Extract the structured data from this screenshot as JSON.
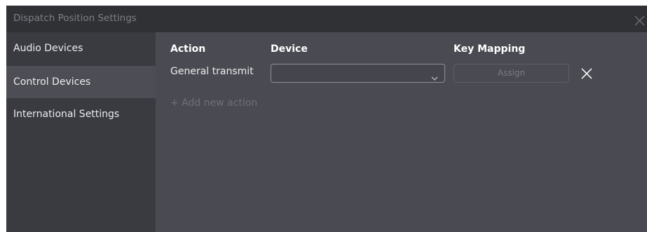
{
  "window": {
    "title": "Dispatch Position Settings",
    "close_icon": "close-icon"
  },
  "sidebar": {
    "items": [
      {
        "label": "Audio Devices",
        "active": false
      },
      {
        "label": "Control Devices",
        "active": true
      },
      {
        "label": "International Settings",
        "active": false
      }
    ]
  },
  "table": {
    "headers": {
      "action": "Action",
      "device": "Device",
      "key_mapping": "Key Mapping"
    },
    "rows": [
      {
        "action": "General transmit",
        "device": "",
        "assign_label": "Assign",
        "assign_enabled": false,
        "remove_icon": "close-icon"
      }
    ],
    "add_action_label": "+ Add new action"
  },
  "colors": {
    "titlebar": "#303135",
    "sidebar": "#3a3b41",
    "sidebar_active": "#4d4e55",
    "content": "#4a4b52"
  }
}
